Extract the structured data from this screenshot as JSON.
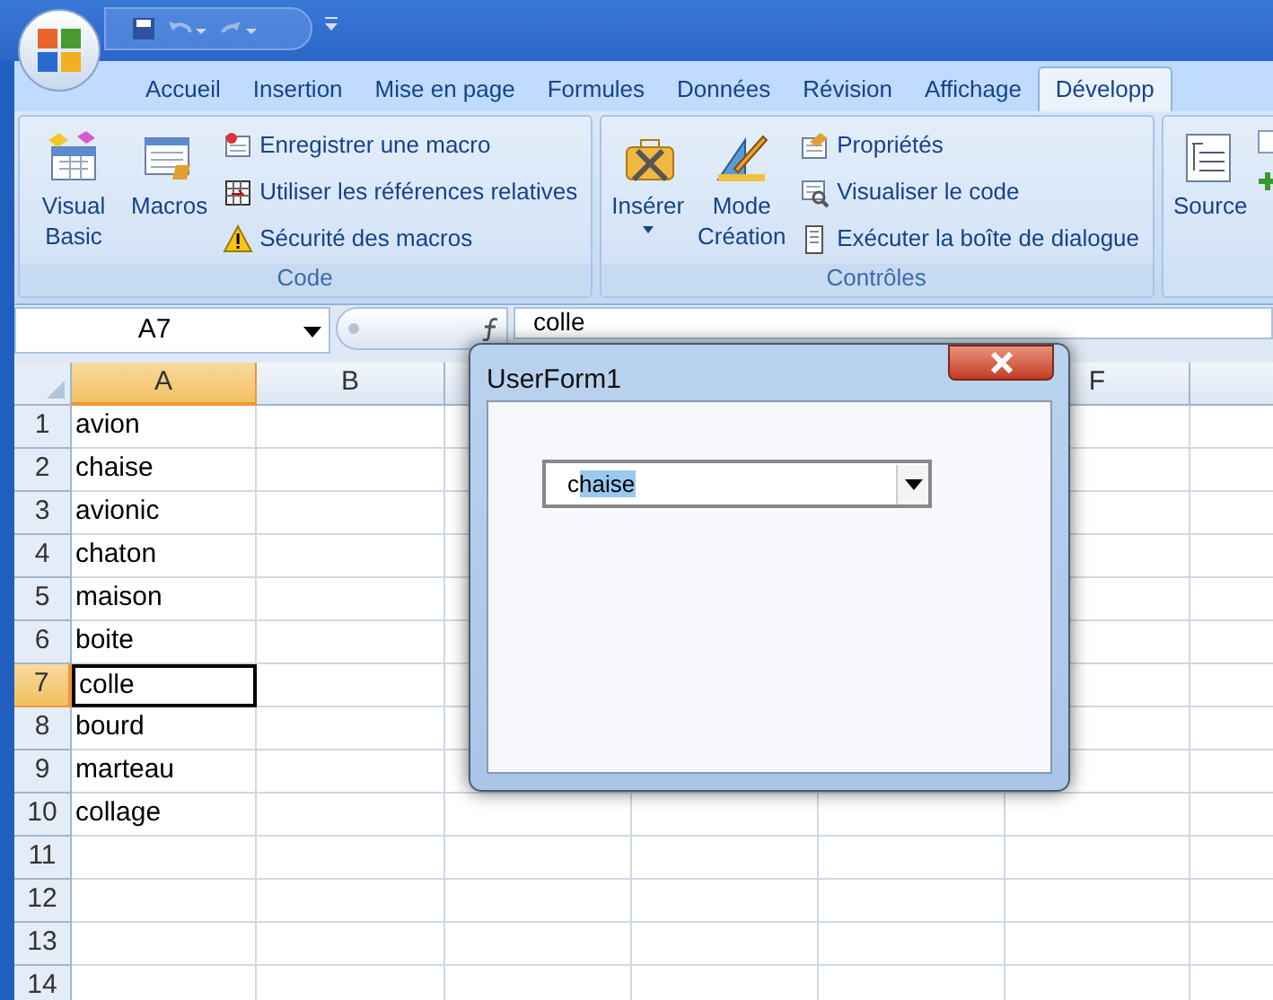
{
  "tabs": [
    {
      "label": "Accueil",
      "selected": false
    },
    {
      "label": "Insertion",
      "selected": false
    },
    {
      "label": "Mise en page",
      "selected": false
    },
    {
      "label": "Formules",
      "selected": false
    },
    {
      "label": "Données",
      "selected": false
    },
    {
      "label": "Révision",
      "selected": false
    },
    {
      "label": "Affichage",
      "selected": false
    },
    {
      "label": "Développ",
      "selected": true
    }
  ],
  "ribbon": {
    "groups": [
      {
        "label": "Code",
        "items": [
          {
            "kind": "large",
            "label": "Visual Basic"
          },
          {
            "kind": "large",
            "label": "Macros"
          },
          {
            "kind": "small",
            "label": "Enregistrer une macro"
          },
          {
            "kind": "small",
            "label": "Utiliser les références relatives"
          },
          {
            "kind": "small",
            "label": "Sécurité des macros"
          }
        ]
      },
      {
        "label": "Contrôles",
        "items": [
          {
            "kind": "large",
            "label": "Insérer",
            "dropdown": true
          },
          {
            "kind": "large",
            "label": "Mode Création"
          },
          {
            "kind": "small",
            "label": "Propriétés"
          },
          {
            "kind": "small",
            "label": "Visualiser le code"
          },
          {
            "kind": "small",
            "label": "Exécuter la boîte de dialogue"
          }
        ]
      },
      {
        "items": [
          {
            "kind": "large",
            "label": "Source"
          }
        ]
      }
    ]
  },
  "formula_bar": {
    "name_box": "A7",
    "formula": "colle"
  },
  "sheet": {
    "columns": [
      {
        "label": "A",
        "selected": true
      },
      {
        "label": "B",
        "selected": false
      },
      {
        "label": "F",
        "selected": false
      }
    ],
    "rows": [
      {
        "number": "1",
        "a": "avion",
        "selected": false
      },
      {
        "number": "2",
        "a": "chaise",
        "selected": false
      },
      {
        "number": "3",
        "a": "avionic",
        "selected": false
      },
      {
        "number": "4",
        "a": "chaton",
        "selected": false
      },
      {
        "number": "5",
        "a": "maison",
        "selected": false
      },
      {
        "number": "6",
        "a": "boite",
        "selected": false
      },
      {
        "number": "7",
        "a": "colle",
        "selected": true
      },
      {
        "number": "8",
        "a": "bourd",
        "selected": false
      },
      {
        "number": "9",
        "a": "marteau",
        "selected": false
      },
      {
        "number": "10",
        "a": "collage",
        "selected": false
      },
      {
        "number": "11",
        "selected": false
      },
      {
        "number": "12",
        "selected": false
      },
      {
        "number": "13",
        "selected": false
      },
      {
        "number": "14",
        "selected": false
      }
    ]
  },
  "dialog": {
    "title": "UserForm1",
    "combo": {
      "text_before": "c",
      "text_selected": "haise"
    }
  }
}
